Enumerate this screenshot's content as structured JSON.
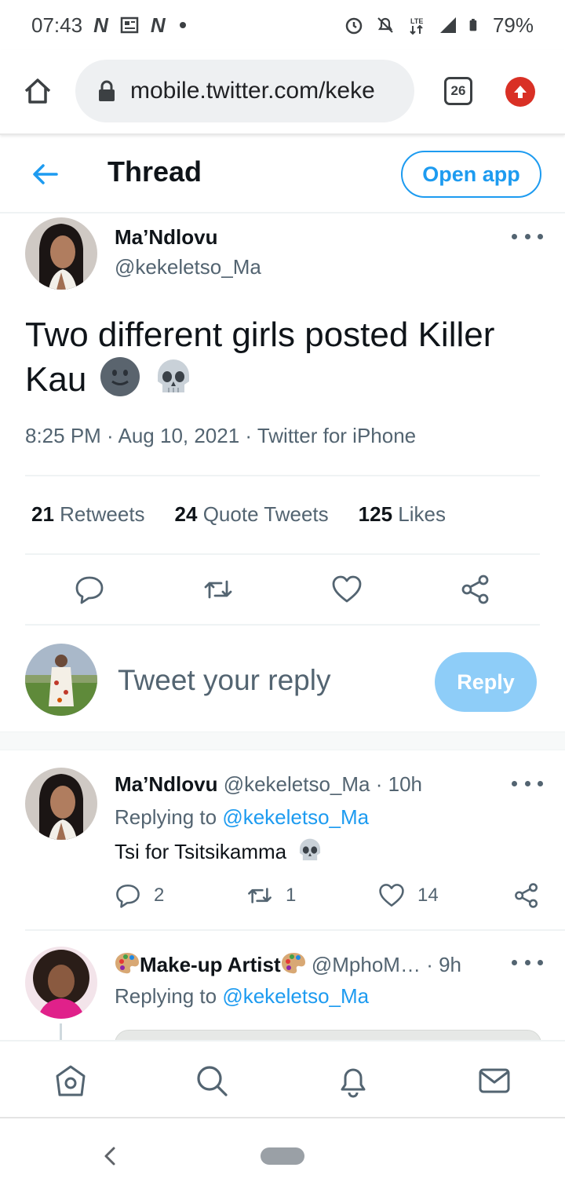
{
  "status_bar": {
    "time": "07:43",
    "notif_letters": [
      "N",
      "N"
    ],
    "network": "LTE",
    "battery": "79%"
  },
  "browser": {
    "url": "mobile.twitter.com/keke",
    "tab_count": "26"
  },
  "header": {
    "title": "Thread",
    "open_app_label": "Open app"
  },
  "main_tweet": {
    "name": "Ma’Ndlovu",
    "handle": "@kekeletso_Ma",
    "text": "Two different girls posted Killer Kau",
    "meta": "8:25 PM · Aug 10, 2021 · Twitter for iPhone",
    "retweets_count": "21",
    "retweets_label": "Retweets",
    "quotes_count": "24",
    "quotes_label": "Quote Tweets",
    "likes_count": "125",
    "likes_label": "Likes"
  },
  "composer": {
    "placeholder": "Tweet your reply",
    "reply_label": "Reply"
  },
  "replies": [
    {
      "name": "Ma’Ndlovu",
      "handle": "@kekeletso_Ma",
      "time": "· 10h",
      "replying_prefix": "Replying to",
      "replying_to": "@kekeletso_Ma",
      "text": "Tsi for Tsitsikamma",
      "reply_count": "2",
      "retweet_count": "1",
      "like_count": "14"
    },
    {
      "name": "Make-up Artist",
      "handle": "@MphoM…",
      "time": "· 9h",
      "replying_prefix": "Replying to",
      "replying_to": "@kekeletso_Ma"
    }
  ],
  "colors": {
    "accent": "#1d9bf0",
    "reply_button": "#8ecdf8",
    "secondary_text": "#536471",
    "update_badge": "#d93025"
  }
}
